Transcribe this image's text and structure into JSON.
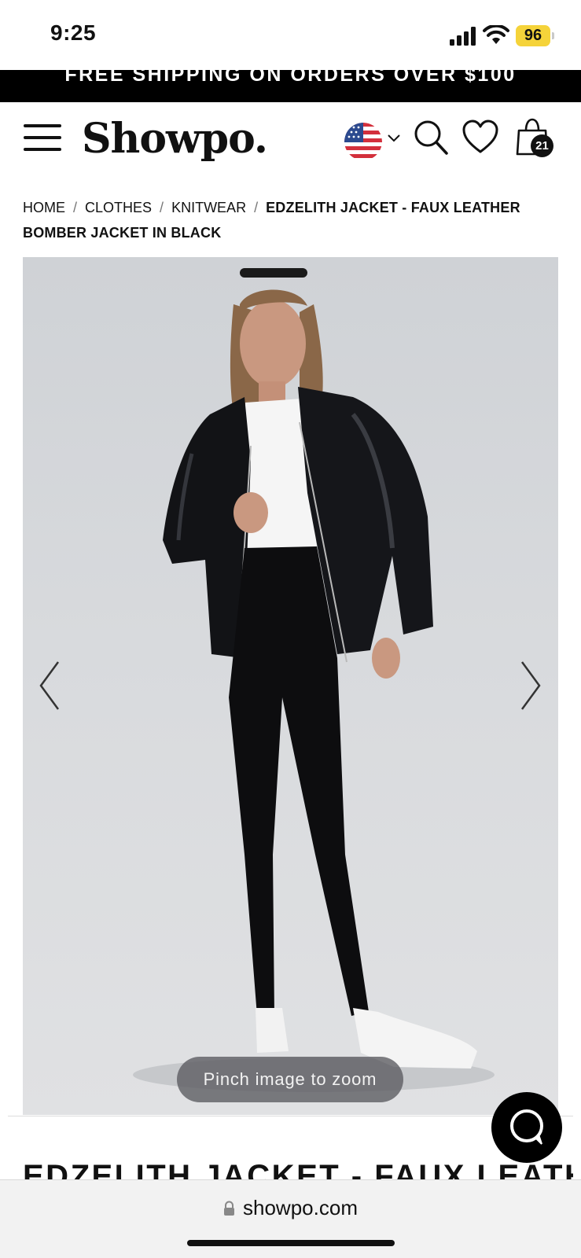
{
  "status_bar": {
    "time": "9:25",
    "battery": "96"
  },
  "promo": {
    "text": "FREE SHIPPING ON ORDERS OVER $100"
  },
  "header": {
    "logo": "Showpo.",
    "cart_count": "21",
    "icons": [
      "menu-icon",
      "us-flag-icon",
      "chevron-down-icon",
      "search-icon",
      "heart-icon",
      "shopping-bag-icon"
    ]
  },
  "breadcrumb": {
    "items": [
      "HOME",
      "CLOTHES",
      "KNITWEAR"
    ],
    "separator": "/",
    "current": "EDZELITH JACKET - FAUX LEATHER BOMBER JACKET IN BLACK"
  },
  "gallery": {
    "zoom_hint": "Pinch image to zoom",
    "prev_icon": "chevron-left-icon",
    "next_icon": "chevron-right-icon"
  },
  "product": {
    "title": "EDZELITH JACKET - FAUX LEATHER"
  },
  "chat": {
    "icon": "chat-bubble-icon"
  },
  "browser": {
    "url": "showpo.com"
  }
}
